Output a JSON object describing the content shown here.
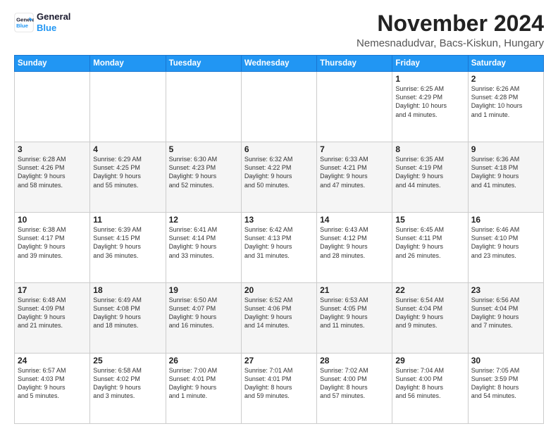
{
  "logo": {
    "line1": "General",
    "line2": "Blue"
  },
  "title": "November 2024",
  "location": "Nemesnadudvar, Bacs-Kiskun, Hungary",
  "days_of_week": [
    "Sunday",
    "Monday",
    "Tuesday",
    "Wednesday",
    "Thursday",
    "Friday",
    "Saturday"
  ],
  "weeks": [
    [
      {
        "num": "",
        "info": ""
      },
      {
        "num": "",
        "info": ""
      },
      {
        "num": "",
        "info": ""
      },
      {
        "num": "",
        "info": ""
      },
      {
        "num": "",
        "info": ""
      },
      {
        "num": "1",
        "info": "Sunrise: 6:25 AM\nSunset: 4:29 PM\nDaylight: 10 hours\nand 4 minutes."
      },
      {
        "num": "2",
        "info": "Sunrise: 6:26 AM\nSunset: 4:28 PM\nDaylight: 10 hours\nand 1 minute."
      }
    ],
    [
      {
        "num": "3",
        "info": "Sunrise: 6:28 AM\nSunset: 4:26 PM\nDaylight: 9 hours\nand 58 minutes."
      },
      {
        "num": "4",
        "info": "Sunrise: 6:29 AM\nSunset: 4:25 PM\nDaylight: 9 hours\nand 55 minutes."
      },
      {
        "num": "5",
        "info": "Sunrise: 6:30 AM\nSunset: 4:23 PM\nDaylight: 9 hours\nand 52 minutes."
      },
      {
        "num": "6",
        "info": "Sunrise: 6:32 AM\nSunset: 4:22 PM\nDaylight: 9 hours\nand 50 minutes."
      },
      {
        "num": "7",
        "info": "Sunrise: 6:33 AM\nSunset: 4:21 PM\nDaylight: 9 hours\nand 47 minutes."
      },
      {
        "num": "8",
        "info": "Sunrise: 6:35 AM\nSunset: 4:19 PM\nDaylight: 9 hours\nand 44 minutes."
      },
      {
        "num": "9",
        "info": "Sunrise: 6:36 AM\nSunset: 4:18 PM\nDaylight: 9 hours\nand 41 minutes."
      }
    ],
    [
      {
        "num": "10",
        "info": "Sunrise: 6:38 AM\nSunset: 4:17 PM\nDaylight: 9 hours\nand 39 minutes."
      },
      {
        "num": "11",
        "info": "Sunrise: 6:39 AM\nSunset: 4:15 PM\nDaylight: 9 hours\nand 36 minutes."
      },
      {
        "num": "12",
        "info": "Sunrise: 6:41 AM\nSunset: 4:14 PM\nDaylight: 9 hours\nand 33 minutes."
      },
      {
        "num": "13",
        "info": "Sunrise: 6:42 AM\nSunset: 4:13 PM\nDaylight: 9 hours\nand 31 minutes."
      },
      {
        "num": "14",
        "info": "Sunrise: 6:43 AM\nSunset: 4:12 PM\nDaylight: 9 hours\nand 28 minutes."
      },
      {
        "num": "15",
        "info": "Sunrise: 6:45 AM\nSunset: 4:11 PM\nDaylight: 9 hours\nand 26 minutes."
      },
      {
        "num": "16",
        "info": "Sunrise: 6:46 AM\nSunset: 4:10 PM\nDaylight: 9 hours\nand 23 minutes."
      }
    ],
    [
      {
        "num": "17",
        "info": "Sunrise: 6:48 AM\nSunset: 4:09 PM\nDaylight: 9 hours\nand 21 minutes."
      },
      {
        "num": "18",
        "info": "Sunrise: 6:49 AM\nSunset: 4:08 PM\nDaylight: 9 hours\nand 18 minutes."
      },
      {
        "num": "19",
        "info": "Sunrise: 6:50 AM\nSunset: 4:07 PM\nDaylight: 9 hours\nand 16 minutes."
      },
      {
        "num": "20",
        "info": "Sunrise: 6:52 AM\nSunset: 4:06 PM\nDaylight: 9 hours\nand 14 minutes."
      },
      {
        "num": "21",
        "info": "Sunrise: 6:53 AM\nSunset: 4:05 PM\nDaylight: 9 hours\nand 11 minutes."
      },
      {
        "num": "22",
        "info": "Sunrise: 6:54 AM\nSunset: 4:04 PM\nDaylight: 9 hours\nand 9 minutes."
      },
      {
        "num": "23",
        "info": "Sunrise: 6:56 AM\nSunset: 4:04 PM\nDaylight: 9 hours\nand 7 minutes."
      }
    ],
    [
      {
        "num": "24",
        "info": "Sunrise: 6:57 AM\nSunset: 4:03 PM\nDaylight: 9 hours\nand 5 minutes."
      },
      {
        "num": "25",
        "info": "Sunrise: 6:58 AM\nSunset: 4:02 PM\nDaylight: 9 hours\nand 3 minutes."
      },
      {
        "num": "26",
        "info": "Sunrise: 7:00 AM\nSunset: 4:01 PM\nDaylight: 9 hours\nand 1 minute."
      },
      {
        "num": "27",
        "info": "Sunrise: 7:01 AM\nSunset: 4:01 PM\nDaylight: 8 hours\nand 59 minutes."
      },
      {
        "num": "28",
        "info": "Sunrise: 7:02 AM\nSunset: 4:00 PM\nDaylight: 8 hours\nand 57 minutes."
      },
      {
        "num": "29",
        "info": "Sunrise: 7:04 AM\nSunset: 4:00 PM\nDaylight: 8 hours\nand 56 minutes."
      },
      {
        "num": "30",
        "info": "Sunrise: 7:05 AM\nSunset: 3:59 PM\nDaylight: 8 hours\nand 54 minutes."
      }
    ]
  ]
}
